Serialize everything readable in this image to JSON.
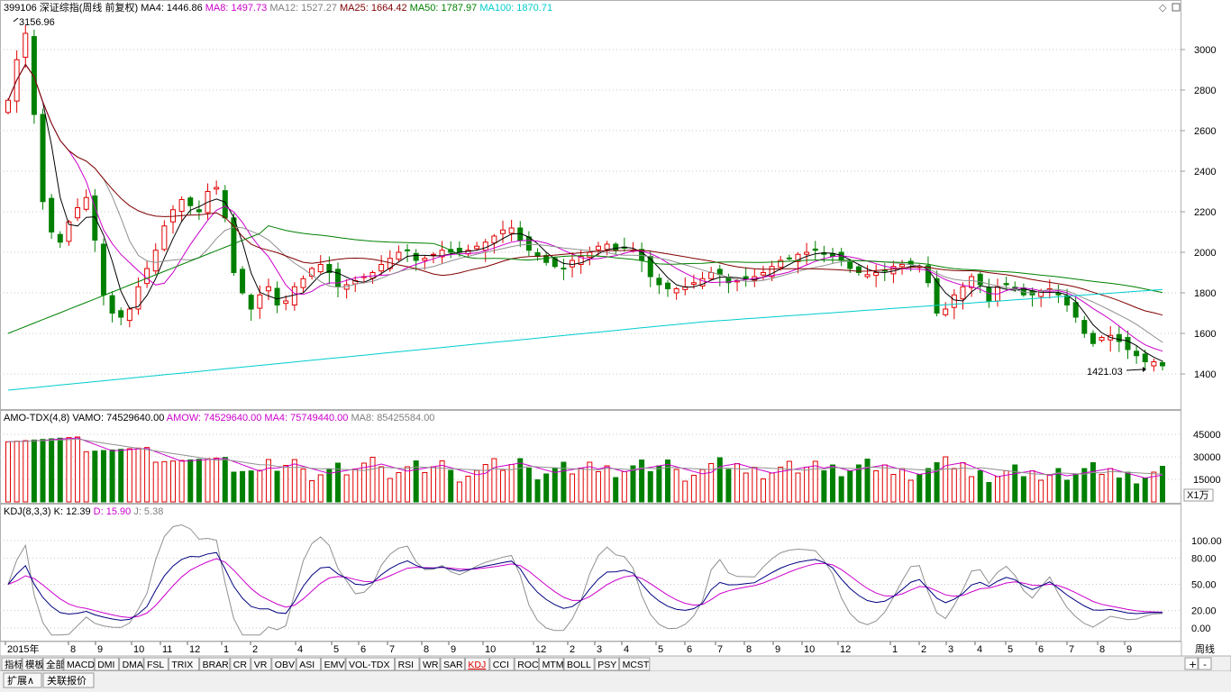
{
  "main_header": {
    "code_name": "399106 深证综指(周线 前复权)",
    "items": [
      {
        "text": "MA4: 1446.86",
        "color": "#000000"
      },
      {
        "text": "MA8: 1497.73",
        "color": "#cc00cc"
      },
      {
        "text": "MA12: 1527.27",
        "color": "#808080"
      },
      {
        "text": "MA25: 1664.42",
        "color": "#800000"
      },
      {
        "text": "MA50: 1787.97",
        "color": "#008000"
      },
      {
        "text": "MA100: 1870.71",
        "color": "#00cccc"
      }
    ]
  },
  "annotations": {
    "high_label": "3156.96",
    "low_label": "1421.03"
  },
  "price_axis": {
    "ticks": [
      "3000",
      "2800",
      "2600",
      "2400",
      "2200",
      "2000",
      "1800",
      "1600",
      "1400"
    ]
  },
  "vol_header": [
    {
      "text": "AMO-TDX(4,8)",
      "color": "#000000"
    },
    {
      "text": "VAMO: 74529640.00",
      "color": "#000000"
    },
    {
      "text": "AMOW: 74529640.00",
      "color": "#cc00cc"
    },
    {
      "text": "MA4: 75749440.00",
      "color": "#cc00cc"
    },
    {
      "text": "MA8: 85425584.00",
      "color": "#808080"
    }
  ],
  "vol_axis": {
    "ticks": [
      "45000",
      "30000",
      "15000"
    ],
    "unit": "X1万"
  },
  "kdj_header": [
    {
      "text": "KDJ(8,3,3)",
      "color": "#000000"
    },
    {
      "text": "K: 12.39",
      "color": "#000000"
    },
    {
      "text": "D: 15.90",
      "color": "#cc00cc"
    },
    {
      "text": "J: 5.38",
      "color": "#808080"
    }
  ],
  "kdj_axis": {
    "ticks": [
      "100.00",
      "80.00",
      "50.00",
      "20.00",
      "0.00"
    ]
  },
  "time_axis": {
    "labels": [
      "2015年",
      "8",
      "9",
      "10",
      "11",
      "12",
      "1",
      "2",
      "4",
      "5",
      "6",
      "7",
      "8",
      "9",
      "10",
      "12",
      "2",
      "3",
      "4",
      "5",
      "6",
      "7",
      "8",
      "9",
      "10",
      "12",
      "1",
      "2",
      "3",
      "4",
      "5",
      "6",
      "7",
      "8",
      "9"
    ],
    "period": "周线"
  },
  "tabs": [
    "指标",
    "模板",
    "全部",
    "MACD",
    "DMI",
    "DMA",
    "FSL",
    "TRIX",
    "BRAR",
    "CR",
    "VR",
    "OBV",
    "ASI",
    "EMV",
    "VOL-TDX",
    "RSI",
    "WR",
    "SAR",
    "KDJ",
    "CCI",
    "ROC",
    "MTM",
    "BOLL",
    "PSY",
    "MCST"
  ],
  "active_tab": "KDJ",
  "footer": {
    "expand": "扩展∧",
    "quote": "关联报价",
    "plus": "+",
    "minus": "-"
  },
  "icons": [
    "diamond-icon",
    "restore-icon"
  ]
}
